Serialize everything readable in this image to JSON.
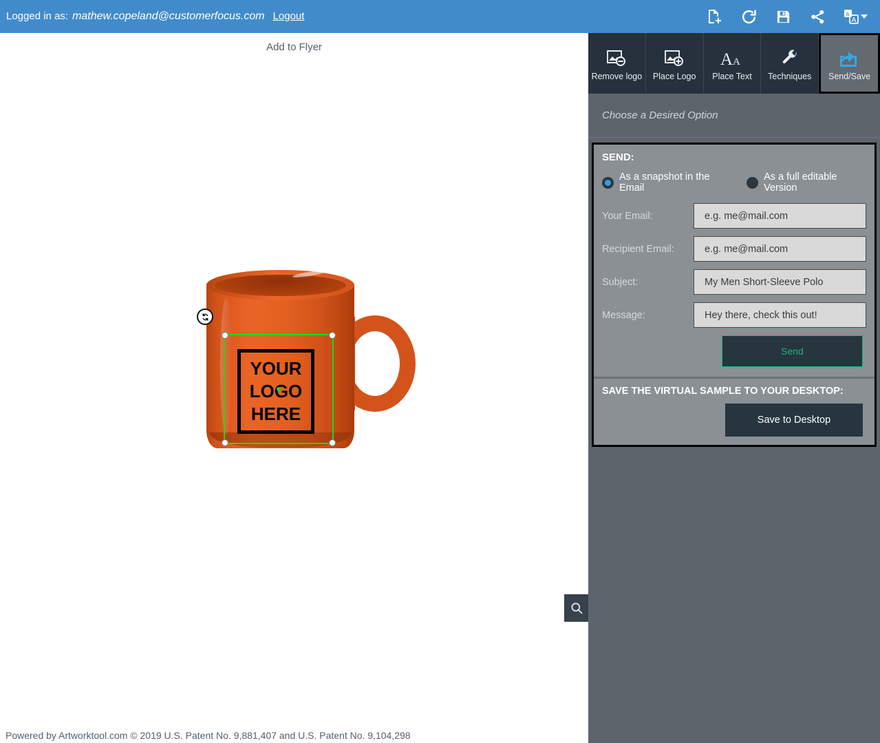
{
  "header": {
    "logged_in_label": "Logged in as:",
    "email": "mathew.copeland@customerfocus.com",
    "logout_label": "Logout",
    "icons": [
      "new-document-icon",
      "refresh-icon",
      "save-icon",
      "share-icon",
      "translate-icon"
    ],
    "accent_color": "#428bcb"
  },
  "canvas": {
    "add_to_flyer_label": "Add to Flyer",
    "product": "coffee-mug",
    "product_color": "#d4531a",
    "logo_placeholder": {
      "line1": "YOUR",
      "line2": "LOGO",
      "line3": "HERE",
      "selection_color": "#15e015",
      "selected": true
    },
    "zoom_button_icon": "magnifier-icon"
  },
  "footer": {
    "text": "Powered by Artworktool.com © 2019 U.S. Patent No. 9,881,407 and U.S. Patent No. 9,104,298"
  },
  "toolbar": {
    "tabs": [
      {
        "label": "Remove logo",
        "icon": "image-minus-icon",
        "active": false
      },
      {
        "label": "Place Logo",
        "icon": "image-plus-icon",
        "active": false
      },
      {
        "label": "Place Text",
        "icon": "text-aa-icon",
        "active": false
      },
      {
        "label": "Techniques",
        "icon": "wrench-icon",
        "active": false
      },
      {
        "label": "Send/Save",
        "icon": "share-export-icon",
        "active": true
      }
    ]
  },
  "panel": {
    "choose_option_text": "Choose a Desired Option",
    "send": {
      "title": "SEND:",
      "options": [
        {
          "label": "As a snapshot in the Email",
          "selected": true
        },
        {
          "label": "As a full editable Version",
          "selected": false
        }
      ],
      "fields": [
        {
          "label": "Your Email:",
          "value": "",
          "placeholder": "e.g. me@mail.com"
        },
        {
          "label": "Recipient Email:",
          "value": "",
          "placeholder": "e.g. me@mail.com"
        },
        {
          "label": "Subject:",
          "value": "My Men Short-Sleeve Polo",
          "placeholder": ""
        },
        {
          "label": "Message:",
          "value": "Hey there, check this out!",
          "placeholder": ""
        }
      ],
      "send_button_label": "Send",
      "send_button_color": "#18b57c"
    },
    "save": {
      "title": "SAVE THE VIRTUAL SAMPLE TO YOUR DESKTOP:",
      "button_label": "Save to Desktop"
    }
  }
}
